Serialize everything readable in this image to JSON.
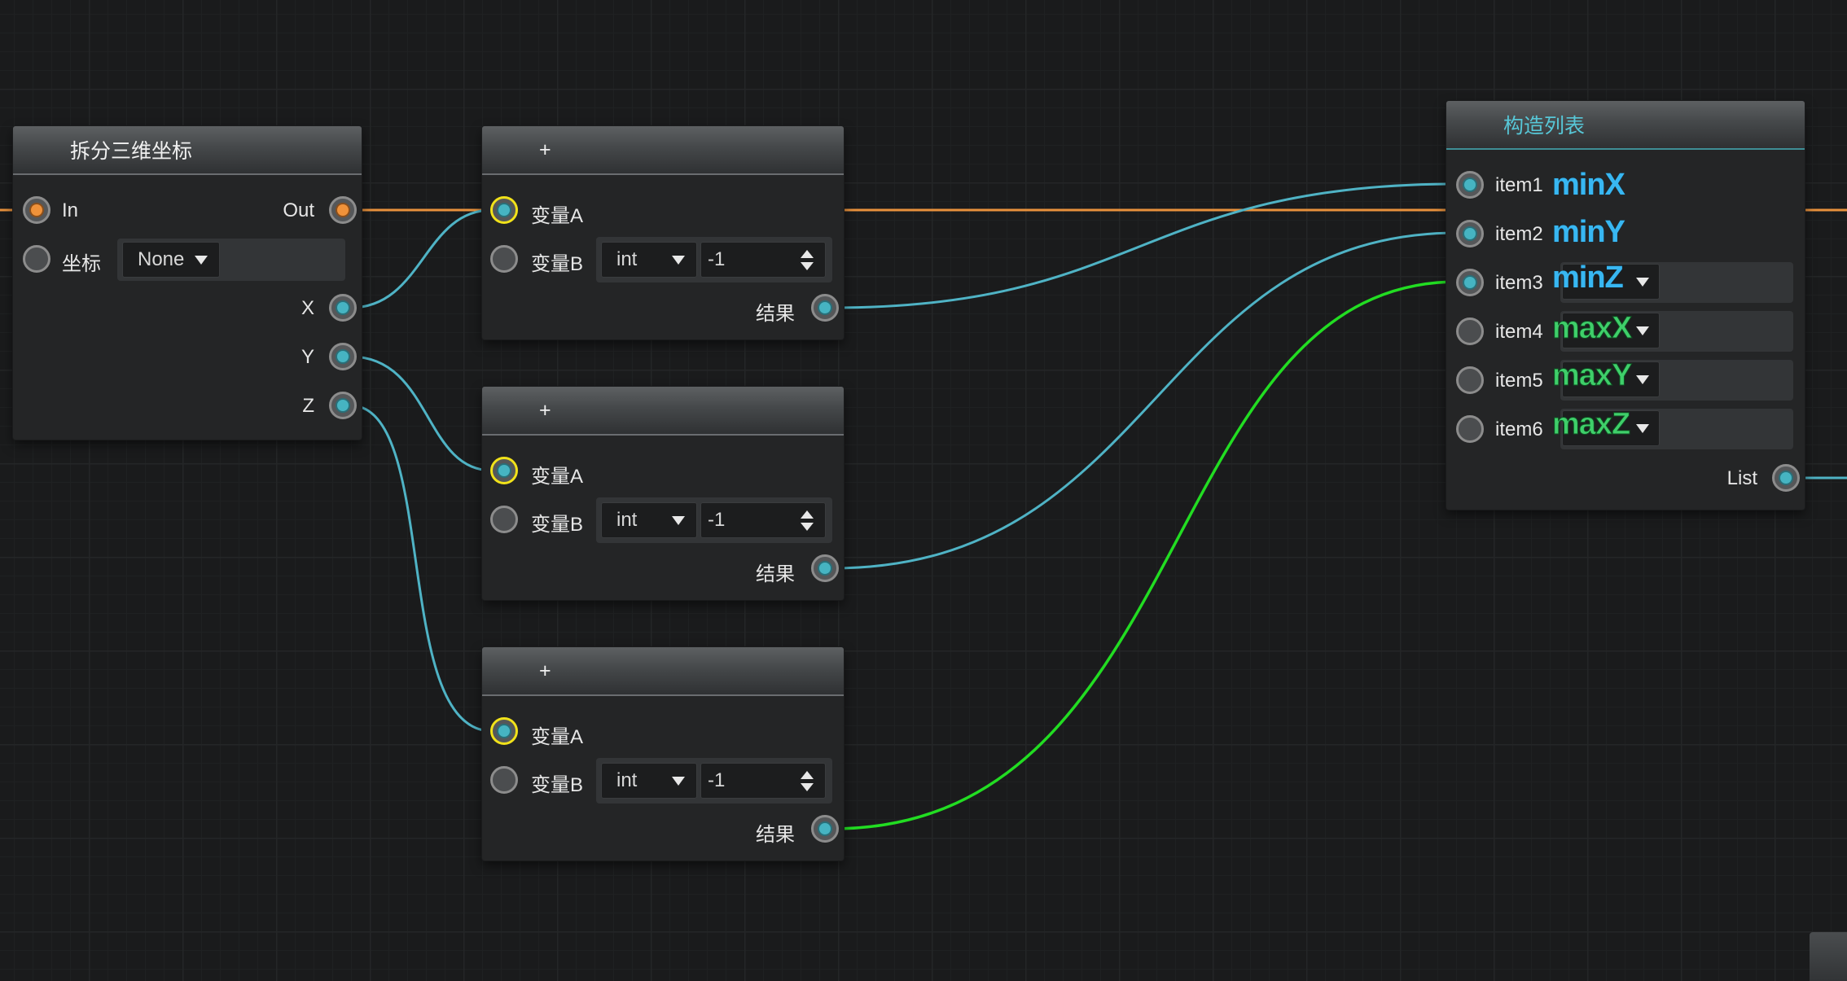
{
  "nodes": {
    "split3d": {
      "title": "拆分三维坐标",
      "in_label": "In",
      "out_label": "Out",
      "coord_label": "坐标",
      "coord_value": "None",
      "x_label": "X",
      "y_label": "Y",
      "z_label": "Z"
    },
    "adders": [
      {
        "title": "+",
        "var_a": "变量A",
        "var_b": "变量B",
        "type_value": "int",
        "spin_value": "-1",
        "result": "结果"
      },
      {
        "title": "+",
        "var_a": "变量A",
        "var_b": "变量B",
        "type_value": "int",
        "spin_value": "-1",
        "result": "结果"
      },
      {
        "title": "+",
        "var_a": "变量A",
        "var_b": "变量B",
        "type_value": "int",
        "spin_value": "-1",
        "result": "结果"
      }
    ],
    "build_list": {
      "title": "构造列表",
      "items": [
        {
          "label": "item1",
          "name": "minX",
          "color": "blue",
          "has_dropdown": false
        },
        {
          "label": "item2",
          "name": "minY",
          "color": "blue",
          "has_dropdown": false
        },
        {
          "label": "item3",
          "name": "minZ",
          "color": "blue",
          "has_dropdown": true
        },
        {
          "label": "item4",
          "name": "maxX",
          "color": "green",
          "has_dropdown": true
        },
        {
          "label": "item5",
          "name": "maxY",
          "color": "green",
          "has_dropdown": true
        },
        {
          "label": "item6",
          "name": "maxZ",
          "color": "green",
          "has_dropdown": true
        }
      ],
      "list_label": "List"
    }
  },
  "colors": {
    "exec_wire": "#e8913c",
    "data_wire": "#4fb3c5",
    "highlight_wire": "#22dd22",
    "port_yellow_ring": "#f1e21a",
    "header_teal_text": "#57c7d7",
    "label_blue": "#38b7f2",
    "label_green": "#3fcf6a"
  }
}
